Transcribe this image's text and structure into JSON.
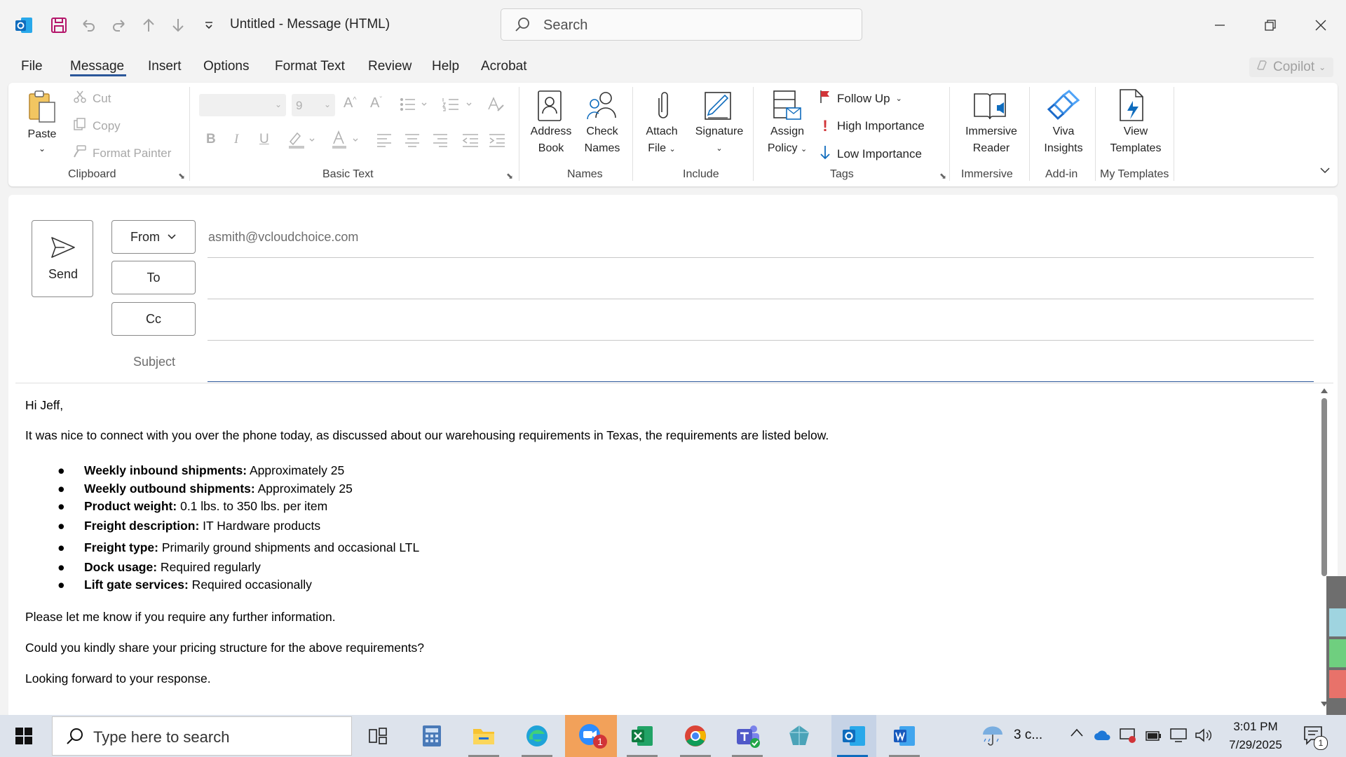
{
  "window": {
    "title": "Untitled  -  Message (HTML)",
    "search_placeholder": "Search"
  },
  "menu": {
    "tabs": [
      "File",
      "Message",
      "Insert",
      "Options",
      "Format Text",
      "Review",
      "Help",
      "Acrobat"
    ],
    "active_tab": "Message",
    "copilot_label": "Copilot"
  },
  "ribbon": {
    "clipboard": {
      "paste": "Paste",
      "cut": "Cut",
      "copy": "Copy",
      "format_painter": "Format Painter",
      "group": "Clipboard"
    },
    "basic_text": {
      "font_size": "9",
      "group": "Basic Text"
    },
    "names": {
      "address_book": [
        "Address",
        "Book"
      ],
      "check_names": [
        "Check",
        "Names"
      ],
      "group": "Names"
    },
    "include": {
      "attach_file": [
        "Attach",
        "File"
      ],
      "signature": "Signature",
      "group": "Include"
    },
    "tags": {
      "assign_policy": [
        "Assign",
        "Policy"
      ],
      "follow_up": "Follow Up",
      "high_importance": "High Importance",
      "low_importance": "Low Importance",
      "group": "Tags"
    },
    "immersive": {
      "immersive_reader": [
        "Immersive",
        "Reader"
      ],
      "group": "Immersive"
    },
    "addin": {
      "viva_insights": [
        "Viva",
        "Insights"
      ],
      "group": "Add-in"
    },
    "templates": {
      "view_templates": [
        "View",
        "Templates"
      ],
      "group": "My Templates"
    }
  },
  "compose": {
    "send": "Send",
    "from_button": "From",
    "from_value": "asmith@vcloudchoice.com",
    "to_button": "To",
    "cc_button": "Cc",
    "subject_label": "Subject",
    "body": {
      "greeting": "Hi Jeff,",
      "intro": "It was nice to connect with you over the phone today, as discussed about our warehousing requirements in Texas, the requirements are listed below.",
      "items": [
        {
          "label": "Weekly inbound shipments:",
          "value": " Approximately 25"
        },
        {
          "label": "Weekly outbound shipments:",
          "value": " Approximately 25"
        },
        {
          "label": "Product weight:",
          "value": " 0.1 lbs. to 350 lbs. per item"
        },
        {
          "label": "Freight description:",
          "value": " IT Hardware products"
        },
        {
          "label": "Freight type:",
          "value": " Primarily ground shipments and occasional LTL"
        },
        {
          "label": "Dock usage:",
          "value": " Required regularly"
        },
        {
          "label": "Lift gate services:",
          "value": " Required occasionally"
        }
      ],
      "para1": "Please let me know if you require any further information.",
      "para2": "Could you kindly share your pricing structure for the above requirements?",
      "para3": "Looking forward to your response."
    }
  },
  "taskbar": {
    "search_placeholder": "Type here to search",
    "weather": "3 c...",
    "time": "3:01 PM",
    "date": "7/29/2025",
    "notification_count": "1",
    "zoom_badge": "1"
  },
  "colors": {
    "accent": "#2b579a",
    "outlook_blue": "#0f6cbd",
    "excel_green": "#107c41",
    "word_blue": "#185abd",
    "flag_red": "#d13438"
  }
}
